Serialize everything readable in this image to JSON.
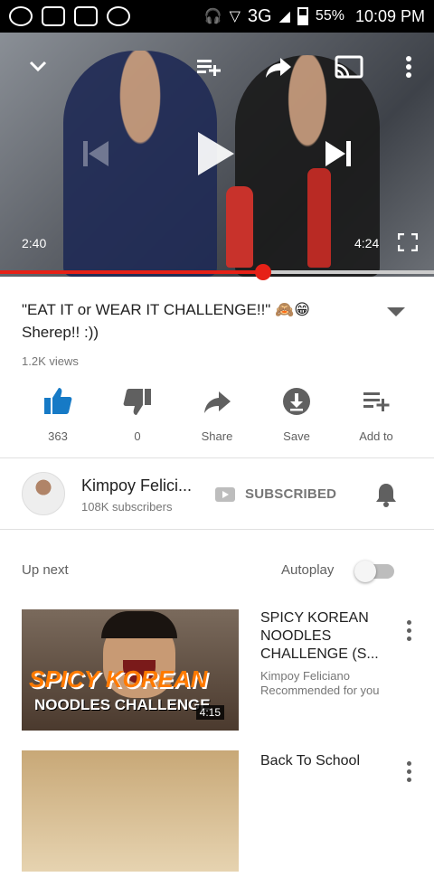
{
  "status_bar": {
    "network": "3G",
    "battery": "55%",
    "time": "10:09 PM"
  },
  "player": {
    "current_time": "2:40",
    "duration": "4:24",
    "progress": 0.606,
    "icons": [
      "chevron-down-icon",
      "add-to-queue-icon",
      "share-icon",
      "cast-icon",
      "more-vert-icon",
      "previous-icon",
      "play-icon",
      "next-icon",
      "fullscreen-icon"
    ]
  },
  "video": {
    "title": "\"EAT IT or WEAR IT CHALLENGE!!\" 🙈😁 Sherep!! :))",
    "views": "1.2K views"
  },
  "actions": [
    {
      "label": "363",
      "icon": "thumbs-up-icon",
      "color": "#167ac6"
    },
    {
      "label": "0",
      "icon": "thumbs-down-icon",
      "color": "#606060"
    },
    {
      "label": "Share",
      "icon": "share-icon",
      "color": "#606060"
    },
    {
      "label": "Save",
      "icon": "download-icon",
      "color": "#606060"
    },
    {
      "label": "Add to",
      "icon": "playlist-add-icon",
      "color": "#606060"
    }
  ],
  "channel": {
    "name": "Kimpoy Felici...",
    "subscribers": "108K subscribers",
    "subscribe_state": "SUBSCRIBED"
  },
  "up_next": {
    "label": "Up next",
    "autoplay_label": "Autoplay",
    "autoplay_on": false
  },
  "recommendations": [
    {
      "title": "SPICY KOREAN NOODLES CHALLENGE (S...",
      "channel": "Kimpoy Feliciano",
      "note": "Recommended for you",
      "duration": "4:15",
      "thumb_text1": "SPICY KOREAN",
      "thumb_text2": "NOODLES CHALLENGE"
    },
    {
      "title": "Back To School"
    }
  ],
  "colors": {
    "accent_red": "#e62117",
    "like_blue": "#167ac6"
  }
}
